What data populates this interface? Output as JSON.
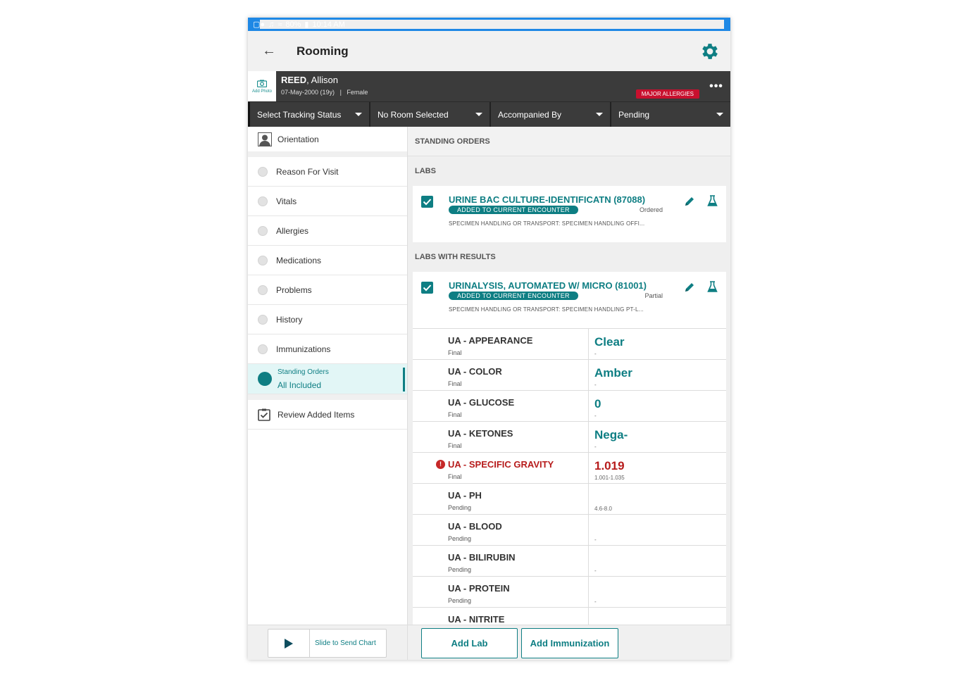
{
  "status_bar": {
    "battery": "80%",
    "time": "10:14 AM"
  },
  "app_bar": {
    "title": "Rooming"
  },
  "patient": {
    "last_name": "REED",
    "first_name": ", Allison",
    "dob": "07-May-2000 (19y)",
    "separator": "|",
    "sex": "Female",
    "allergy_badge": "MAJOR ALLERGIES",
    "add_photo_label": "Add Photo"
  },
  "dropdowns": [
    "Select Tracking Status",
    "No Room Selected",
    "Accompanied By",
    "Pending"
  ],
  "nav": {
    "orientation": "Orientation",
    "items": [
      "Reason For Visit",
      "Vitals",
      "Allergies",
      "Medications",
      "Problems",
      "History",
      "Immunizations"
    ],
    "active_title": "Standing Orders",
    "active_subtitle": "All Included",
    "review": "Review Added Items"
  },
  "main": {
    "standing_orders_header": "STANDING ORDERS",
    "labs_header": "LABS",
    "labs_with_results_header": "LABS WITH RESULTS",
    "lab1": {
      "title": "URINE BAC CULTURE-IDENTIFICATN (87088)",
      "badge": "ADDED TO CURRENT ENCOUNTER",
      "status": "Ordered",
      "sub": "SPECIMEN HANDLING OR TRANSPORT: SPECIMEN HANDLING OFFI..."
    },
    "lab2": {
      "title": "URINALYSIS, AUTOMATED W/ MICRO (81001)",
      "badge": "ADDED TO CURRENT ENCOUNTER",
      "status": "Partial",
      "sub": "SPECIMEN HANDLING OR TRANSPORT: SPECIMEN HANDLING PT-L..."
    },
    "results": [
      {
        "name": "UA - APPEARANCE",
        "status": "Final",
        "value": "Clear",
        "range": "-"
      },
      {
        "name": "UA - COLOR",
        "status": "Final",
        "value": "Amber",
        "range": "-"
      },
      {
        "name": "UA - GLUCOSE",
        "status": "Final",
        "value": "0",
        "range": "-"
      },
      {
        "name": "UA - KETONES",
        "status": "Final",
        "value": "Nega-",
        "range": "-"
      },
      {
        "name": "UA - SPECIFIC GRAVITY",
        "status": "Final",
        "value": "1.019",
        "range": "1.001-1.035",
        "abnormal": true
      },
      {
        "name": "UA - PH",
        "status": "Pending",
        "value": "",
        "range": "4.6-8.0"
      },
      {
        "name": "UA - BLOOD",
        "status": "Pending",
        "value": "",
        "range": "-"
      },
      {
        "name": "UA - BILIRUBIN",
        "status": "Pending",
        "value": "",
        "range": "-"
      },
      {
        "name": "UA - PROTEIN",
        "status": "Pending",
        "value": "",
        "range": "-"
      },
      {
        "name": "UA - NITRITE",
        "status": "",
        "value": "",
        "range": ""
      }
    ]
  },
  "footer": {
    "slide_label": "Slide to Send Chart",
    "add_lab": "Add Lab",
    "add_immunization": "Add Immunization"
  },
  "colors": {
    "accent": "#0e7e83",
    "status_bar": "#1e88e5",
    "banner": "#3b3b3b",
    "alert": "#c8102e"
  }
}
